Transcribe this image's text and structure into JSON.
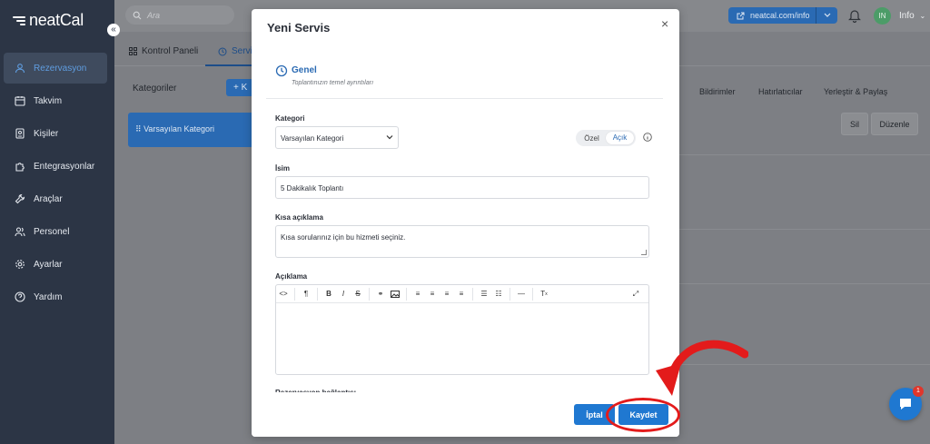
{
  "app": {
    "logo_text": "neatCal"
  },
  "topbar": {
    "search_placeholder": "Ara",
    "url_button": "neatcal.com/info",
    "avatar_initials": "IN",
    "user_name": "Info"
  },
  "sidebar": {
    "items": [
      {
        "label": "Rezervasyon",
        "icon": "user-icon",
        "active": true
      },
      {
        "label": "Takvim",
        "icon": "calendar-icon"
      },
      {
        "label": "Kişiler",
        "icon": "contacts-icon"
      },
      {
        "label": "Entegrasyonlar",
        "icon": "puzzle-icon"
      },
      {
        "label": "Araçlar",
        "icon": "wrench-icon"
      },
      {
        "label": "Personel",
        "icon": "people-icon"
      },
      {
        "label": "Ayarlar",
        "icon": "gear-icon"
      },
      {
        "label": "Yardım",
        "icon": "help-icon"
      }
    ]
  },
  "background": {
    "tabs": [
      "Kontrol Paneli",
      "Servi"
    ],
    "categories_title": "Kategoriler",
    "add_category": "+ K",
    "category_item": "⠿ Varsayılan Kategori",
    "right_tabs": [
      "Bildirimler",
      "Hatırlatıcılar",
      "Yerleştir & Paylaş"
    ],
    "delete_button": "Sil",
    "edit_button": "Düzenle"
  },
  "modal": {
    "title": "Yeni Servis",
    "close_glyph": "×",
    "section_title": "Genel",
    "section_subtitle": "Toplantınızın temel ayrıntıları",
    "category_label": "Kategori",
    "category_value": "Varsayılan Kategori",
    "toggle_private": "Özel",
    "toggle_open": "Açık",
    "name_label": "İsim",
    "name_value": "5 Dakikalık Toplantı",
    "short_desc_label": "Kısa açıklama",
    "short_desc_value": "Kısa sorularınız için bu hizmeti seçiniz.",
    "desc_label": "Açıklama",
    "next_label_partial": "Rezervasyon bağlantısı",
    "cancel_button": "İptal",
    "save_button": "Kaydet"
  },
  "chat": {
    "badge_count": "1"
  },
  "colors": {
    "primary": "#1f78d1",
    "sidebar": "#2c3545",
    "highlight": "#e31b1b"
  }
}
